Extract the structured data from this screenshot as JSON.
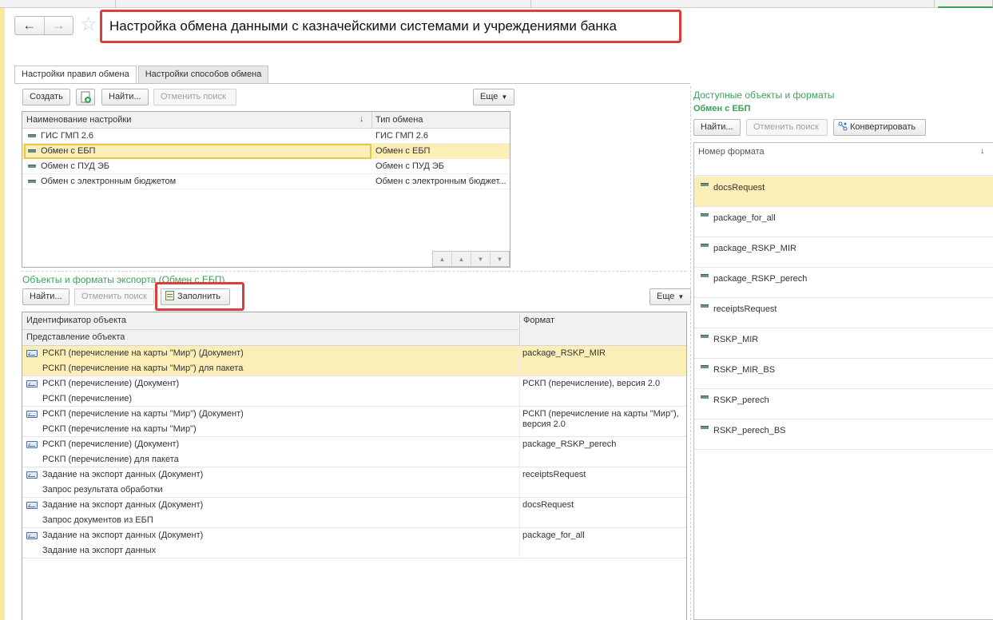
{
  "window": {
    "title": "Настройка обмена данными с казначейскими системами и учреждениями банка"
  },
  "nav": {
    "back": "←",
    "forward": "→",
    "favorite": "☆"
  },
  "tabs": [
    {
      "label": "Настройки правил обмена",
      "active": true
    },
    {
      "label": "Настройки способов обмена",
      "active": false
    }
  ],
  "rules_toolbar": {
    "create": "Создать",
    "find": "Найти...",
    "cancel_search": "Отменить поиск",
    "more": "Еще"
  },
  "rules_table": {
    "columns": [
      "Наименование настройки",
      "Тип обмена"
    ],
    "sort_indicator": "↓",
    "rows": [
      {
        "name": "ГИС ГМП 2.6",
        "type": "ГИС ГМП 2.6",
        "selected": false
      },
      {
        "name": "Обмен с ЕБП",
        "type": "Обмен с ЕБП",
        "selected": true
      },
      {
        "name": "Обмен с ПУД ЭБ",
        "type": "Обмен с ПУД ЭБ",
        "selected": false
      },
      {
        "name": "Обмен с электронным бюджетом",
        "type": "Обмен с электронным бюджет...",
        "selected": false
      }
    ]
  },
  "export": {
    "title": "Объекты и форматы экспорта (Обмен с ЕБП)",
    "toolbar": {
      "find": "Найти...",
      "cancel_search": "Отменить поиск",
      "fill": "Заполнить",
      "more": "Еще"
    },
    "columns": {
      "id": "Идентификатор объекта",
      "repr": "Представление объекта",
      "format": "Формат"
    },
    "rows": [
      {
        "id": "РСКП (перечисление на карты \"Мир\") (Документ)",
        "repr": "РСКП (перечисление на карты \"Мир\") для пакета",
        "format": [
          "package_RSKP_MIR"
        ],
        "selected": true
      },
      {
        "id": "РСКП (перечисление) (Документ)",
        "repr": "РСКП (перечисление)",
        "format": [
          "РСКП (перечисление), версия 2.0"
        ],
        "selected": false
      },
      {
        "id": "РСКП (перечисление на карты \"Мир\") (Документ)",
        "repr": "РСКП (перечисление на карты \"Мир\")",
        "format": [
          "РСКП (перечисление на карты \"Мир\"),",
          "версия 2.0"
        ],
        "selected": false
      },
      {
        "id": "РСКП (перечисление) (Документ)",
        "repr": "РСКП (перечисление) для пакета",
        "format": [
          "package_RSKP_perech"
        ],
        "selected": false
      },
      {
        "id": "Задание на экспорт данных (Документ)",
        "repr": "Запрос результата обработки",
        "format": [
          "receiptsRequest"
        ],
        "selected": false
      },
      {
        "id": "Задание на экспорт данных (Документ)",
        "repr": "Запрос документов из ЕБП",
        "format": [
          "docsRequest"
        ],
        "selected": false
      },
      {
        "id": "Задание на экспорт данных (Документ)",
        "repr": "Задание на экспорт данных",
        "format": [
          "package_for_all"
        ],
        "selected": false
      }
    ]
  },
  "available": {
    "title": "Доступные объекты и форматы",
    "subtitle": "Обмен с ЕБП",
    "toolbar": {
      "find": "Найти...",
      "cancel_search": "Отменить поиск",
      "convert": "Конвертировать"
    },
    "column": "Номер формата",
    "sort_indicator": "↓",
    "rows": [
      {
        "label": "docsRequest",
        "selected": true
      },
      {
        "label": "package_for_all",
        "selected": false
      },
      {
        "label": "package_RSKP_MIR",
        "selected": false
      },
      {
        "label": "package_RSKP_perech",
        "selected": false
      },
      {
        "label": "receiptsRequest",
        "selected": false
      },
      {
        "label": "RSKP_MIR",
        "selected": false
      },
      {
        "label": "RSKP_MIR_BS",
        "selected": false
      },
      {
        "label": "RSKP_perech",
        "selected": false
      },
      {
        "label": "RSKP_perech_BS",
        "selected": false
      }
    ]
  },
  "colors": {
    "accent_green": "#3aa35a",
    "selection": "#fbeeb6",
    "highlight_red": "#d9403a"
  }
}
